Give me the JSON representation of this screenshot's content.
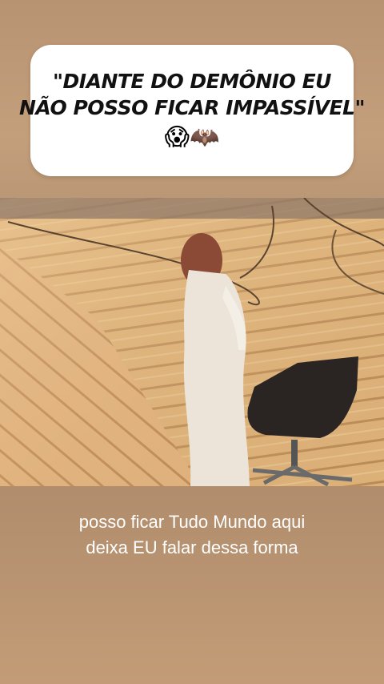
{
  "caption": {
    "line1": "\"DIANTE DO DEMÔNIO EU",
    "line2": "NÃO POSSO FICAR IMPASSÍVEL\"",
    "emoji": "😱🦇"
  },
  "subtitle": {
    "line1": "posso ficar Tudo Mundo aqui",
    "line2": "deixa EU falar dessa forma"
  }
}
